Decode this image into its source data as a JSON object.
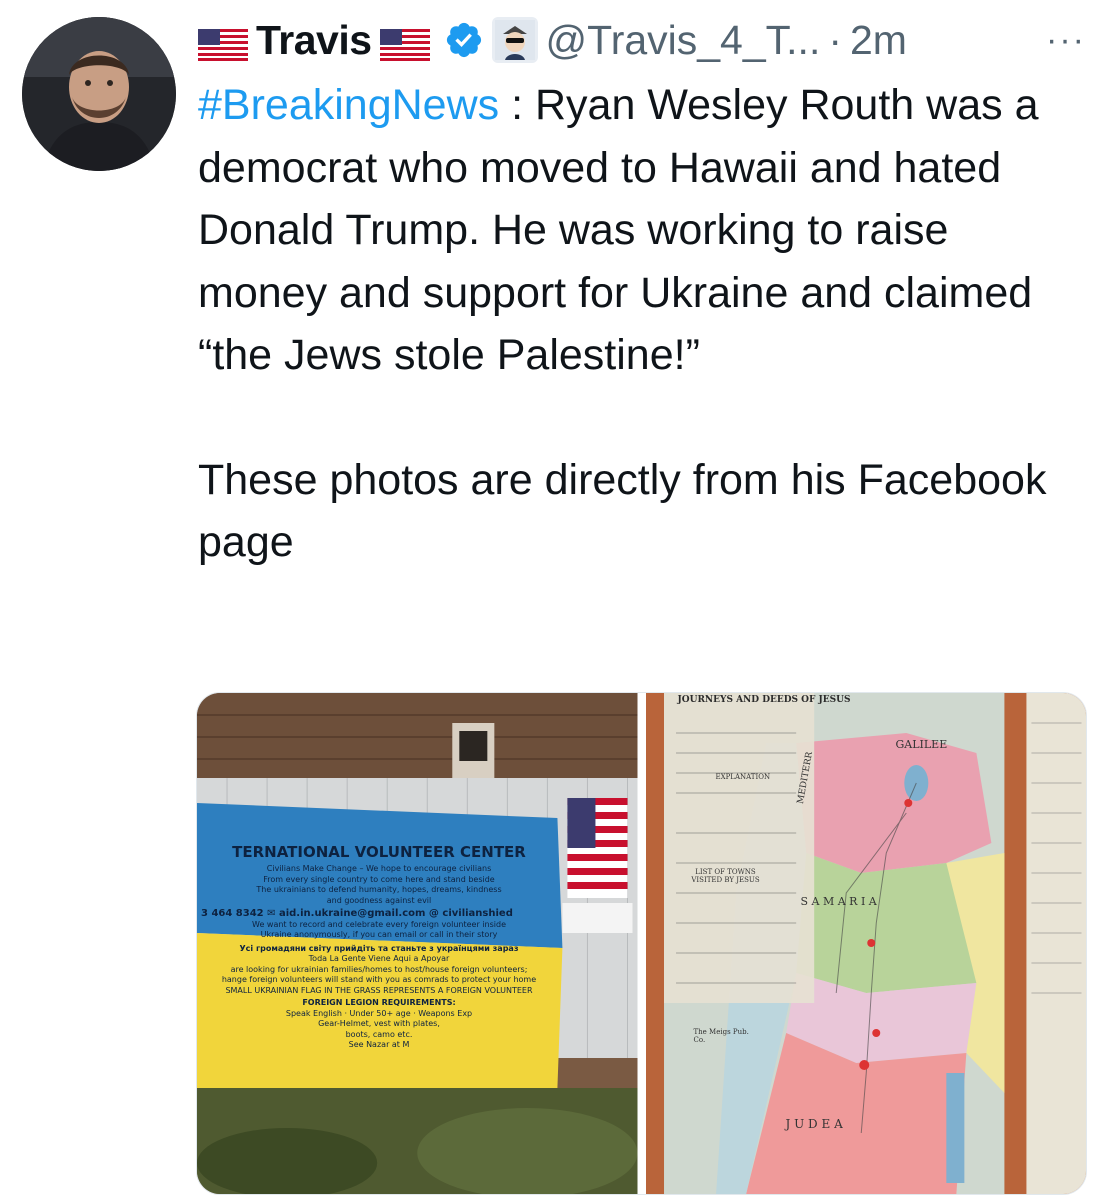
{
  "author": {
    "display_name": "Travis",
    "handle": "@Travis_4_T...",
    "separator": "·",
    "time": "2m",
    "more_label": "···",
    "flag_icon": "us-flag-icon",
    "verified_icon": "verified-badge-icon",
    "badge_icon": "affiliate-badge-icon"
  },
  "tweet": {
    "hashtag": "#BreakingNews",
    "body_line1": " : Ryan Wesley Routh was a democrat who moved to Hawaii and hated Donald Trump.  He was working to raise money and support for Ukraine and claimed “the Jews stole Palestine!”",
    "body_line2": "These photos are directly from his Facebook page"
  },
  "media": {
    "photo1": {
      "banner_title": "TERNATIONAL VOLUNTEER CENTER",
      "banner_line1": "Civilians Make Change – We hope to encourage civilians",
      "banner_line2": "From every single country to come here and stand beside",
      "banner_line3": "The ukrainians to defend humanity, hopes, dreams, kindness",
      "banner_line4": "and goodness against evil",
      "banner_contact": "3 464 8342   ✉ aid.in.ukraine@gmail.com   @ civilianshied",
      "banner_line5": "We want to record and celebrate every foreign volunteer inside",
      "banner_line6": "Ukraine anonymously, if you can email or call in their story",
      "banner_line7": "Усі громадяни світу прийдіть та станьте з українцями зараз",
      "banner_line8": "Toda La Gente Viene Aqui a Apoyar",
      "banner_line9": "are looking for ukrainian families/homes to host/house foreign volunteers;",
      "banner_line10": "hange foreign volunteers will stand with you as comrads to protect your home",
      "banner_line11": "SMALL UKRAINIAN FLAG IN THE GRASS REPRESENTS A FOREIGN VOLUNTEER",
      "banner_line12": "FOREIGN LEGION REQUIREMENTS:",
      "banner_line13": "Speak English · Under 50+ age · Weapons Exp",
      "banner_line14": "Gear-Helmet, vest with plates,",
      "banner_line15": "boots, camo etc.",
      "banner_line16": "See Nazar at M"
    },
    "photo2": {
      "map_title": "JOURNEYS AND DEEDS OF JESUS",
      "region_galilee": "GALILEE",
      "region_samaria": "S A M A R I A",
      "region_judea": "J U D E A",
      "region_mediterranean": "MEDITERR",
      "publisher": "The Meigs Pub. Co.",
      "list_title": "LIST OF TOWNS VISITED BY JESUS",
      "explanation": "EXPLANATION"
    }
  },
  "colors": {
    "text": "#0f1419",
    "secondary": "#536471",
    "link": "#1d9bf0",
    "verified": "#1d9bf0"
  }
}
